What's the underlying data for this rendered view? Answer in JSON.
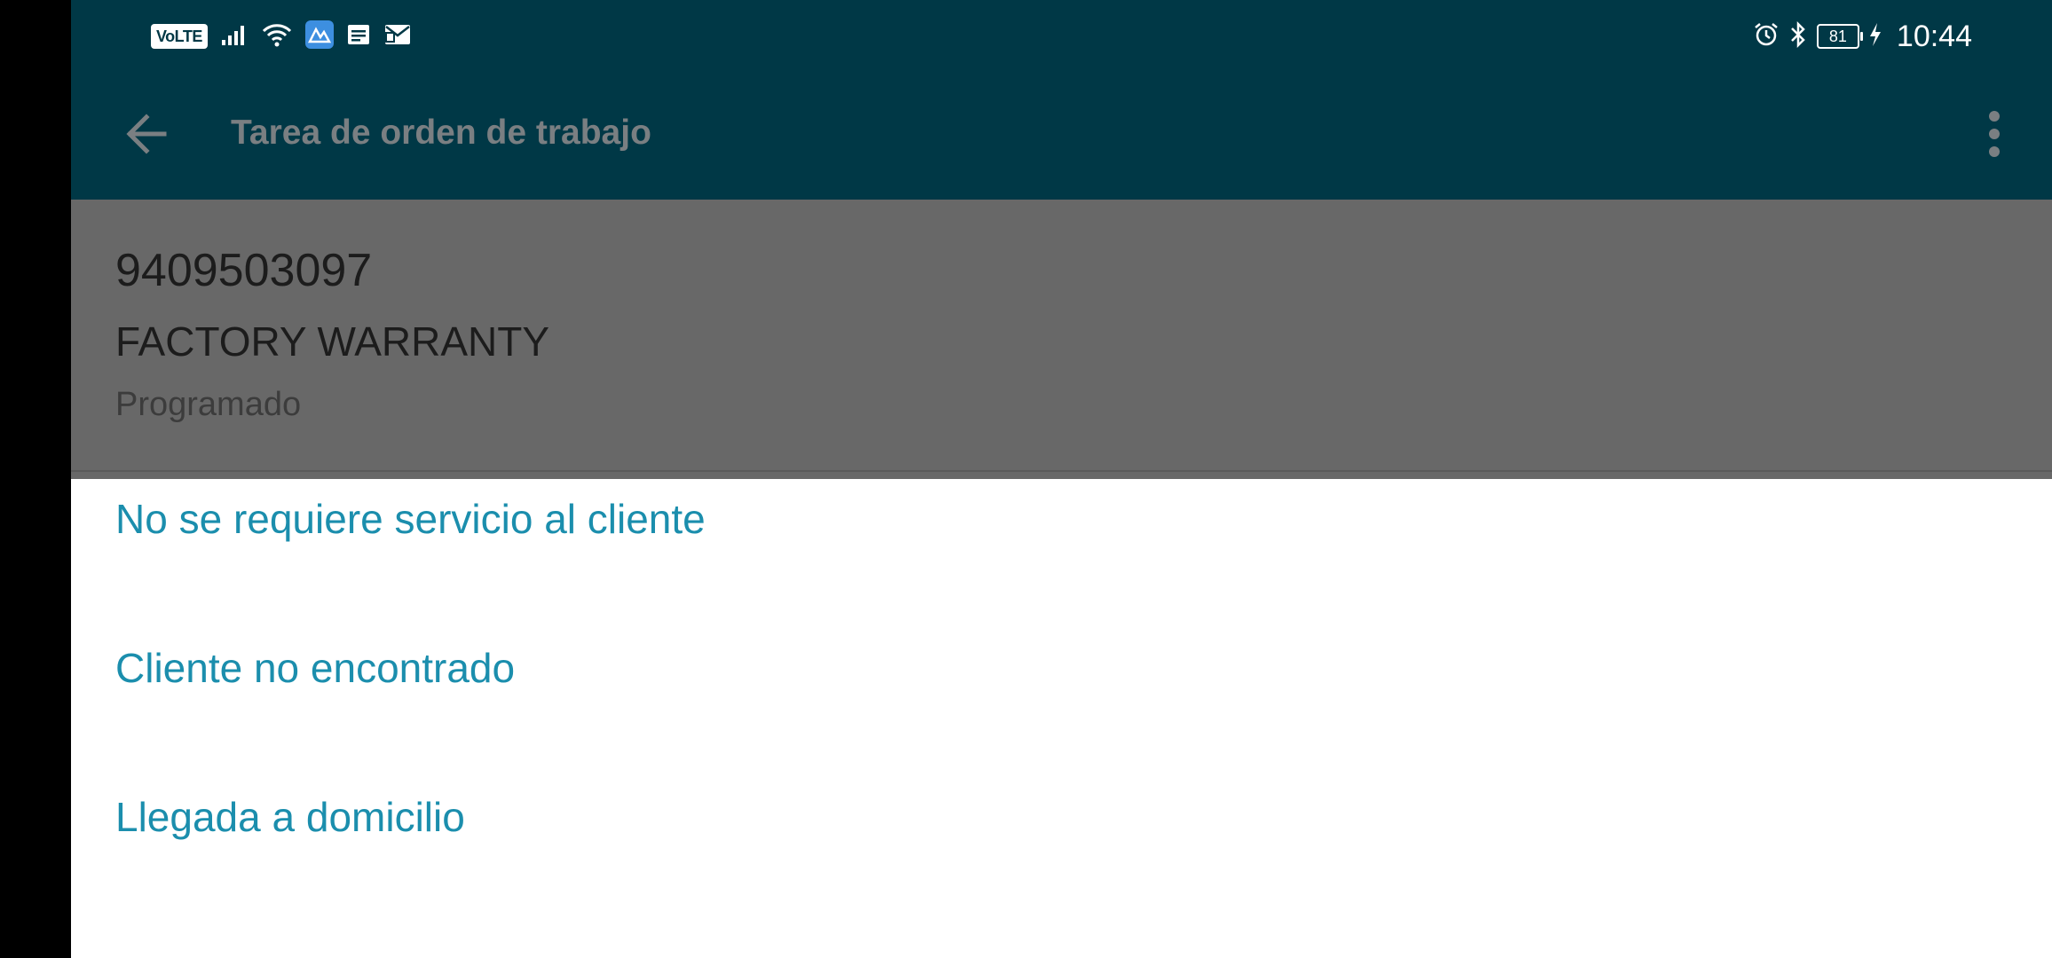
{
  "status_bar": {
    "volte": "VoLTE",
    "battery": "81",
    "time": "10:44",
    "icons": [
      "signal-icon",
      "wifi-icon",
      "app-notification-icon",
      "message-icon",
      "mail-icon",
      "alarm-icon",
      "bluetooth-icon",
      "battery-icon",
      "charging-icon"
    ]
  },
  "toolbar": {
    "title": "Tarea de orden de trabajo",
    "back_icon": "arrow-left-icon",
    "menu_icon": "more-vert-icon"
  },
  "work_order": {
    "number": "9409503097",
    "type": "FACTORY WARRANTY",
    "status": "Programado"
  },
  "options": [
    {
      "label": "No se requiere servicio al cliente"
    },
    {
      "label": "Cliente no encontrado"
    },
    {
      "label": "Llegada a domicilio"
    }
  ],
  "colors": {
    "app_bar": "#003846",
    "scrim_card": "#686868",
    "option_text": "#1b8ead",
    "sheet": "#ffffff"
  }
}
